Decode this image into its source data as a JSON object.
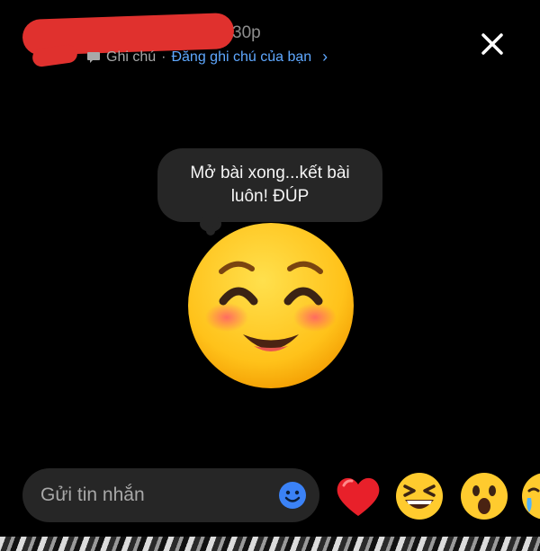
{
  "header": {
    "time_suffix": "30p",
    "note_label": "Ghi chú",
    "separator": " · ",
    "note_link": "Đăng ghi chú của bạn",
    "chevron": "›"
  },
  "note": {
    "line1": "Mở bài xong...kết bài",
    "line2": "luôn! ĐÚP"
  },
  "composer": {
    "placeholder": "Gửi tin nhắn"
  },
  "reactions": [
    "heart",
    "grinning-squinting-face",
    "surprised-face",
    "crying-face"
  ]
}
